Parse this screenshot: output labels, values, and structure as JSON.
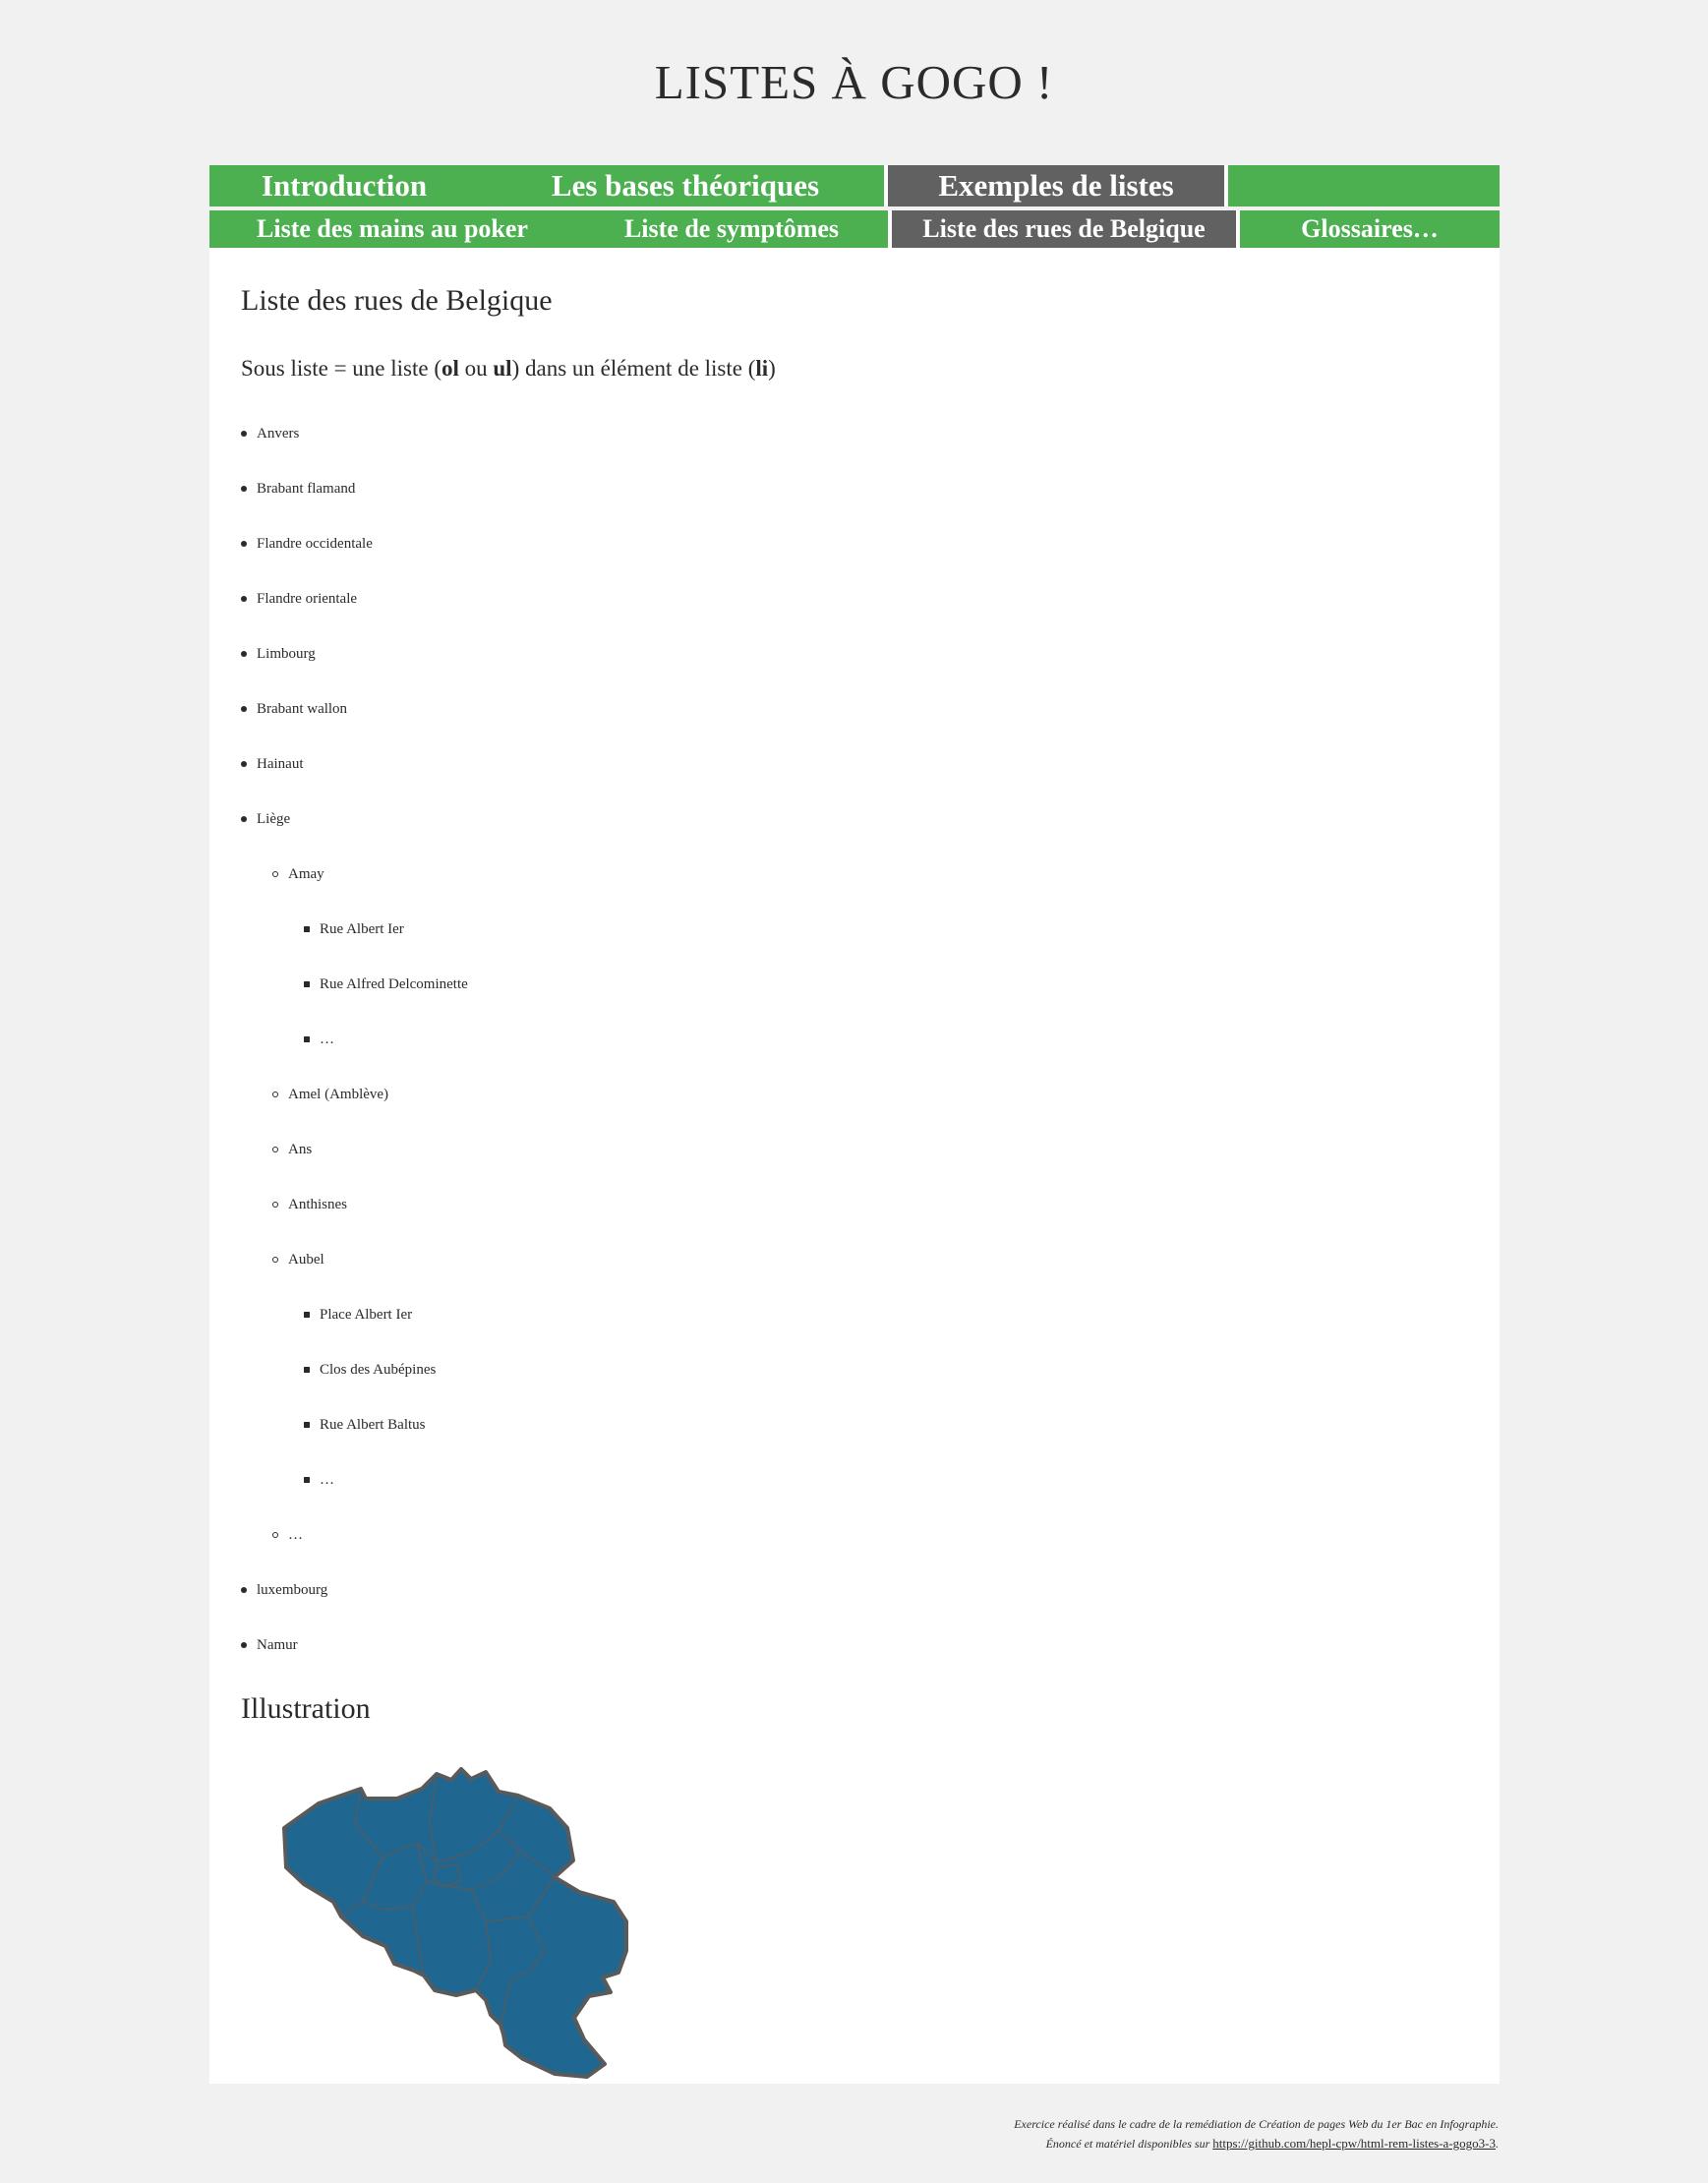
{
  "site": {
    "title": "LISTES À GOGO !"
  },
  "nav_main": [
    {
      "label": "Introduction",
      "active": false
    },
    {
      "label": "Les bases théoriques",
      "active": false
    },
    {
      "label": "Exemples de listes",
      "active": true
    }
  ],
  "nav_sub": [
    {
      "label": "Liste des mains au poker",
      "active": false
    },
    {
      "label": "Liste de symptômes",
      "active": false
    },
    {
      "label": "Liste des rues de Belgique",
      "active": true
    },
    {
      "label": "Glossaires…",
      "active": false
    }
  ],
  "page": {
    "heading": "Liste des rues de Belgique",
    "intro": {
      "t1": "Sous liste = une liste (",
      "b1": "ol",
      "t2": " ou ",
      "b2": "ul",
      "t3": ") dans un élément de liste (",
      "b3": "li",
      "t4": ")"
    }
  },
  "provinces": [
    {
      "label": "Anvers"
    },
    {
      "label": "Brabant flamand"
    },
    {
      "label": "Flandre occidentale"
    },
    {
      "label": "Flandre orientale"
    },
    {
      "label": "Limbourg"
    },
    {
      "label": "Brabant wallon"
    },
    {
      "label": "Hainaut"
    },
    {
      "label": "Liège",
      "children": [
        {
          "label": "Amay",
          "children": [
            {
              "label": "Rue Albert Ier"
            },
            {
              "label": "Rue Alfred Delcominette"
            },
            {
              "label": "…"
            }
          ]
        },
        {
          "label": "Amel (Amblève)"
        },
        {
          "label": "Ans"
        },
        {
          "label": "Anthisnes"
        },
        {
          "label": "Aubel",
          "children": [
            {
              "label": "Place Albert Ier"
            },
            {
              "label": "Clos des Aubépines"
            },
            {
              "label": "Rue Albert Baltus"
            },
            {
              "label": "…"
            }
          ]
        },
        {
          "label": "…"
        }
      ]
    },
    {
      "label": "luxembourg"
    },
    {
      "label": "Namur"
    }
  ],
  "illustration": {
    "heading": "Illustration",
    "map_fill": "#1f6690",
    "map_border": "#5a5a5a"
  },
  "colors": {
    "nav_green": "#4caf50",
    "nav_active": "#616161",
    "page_bg": "#f1f1f1",
    "content_bg": "#ffffff"
  },
  "footer": {
    "line1": "Exercice réalisé dans le cadre de la remédiation de Création de pages Web du 1er Bac en Infographie.",
    "line2_prefix": "Énoncé et matériel disponibles sur ",
    "link_text": "https://github.com/hepl-cpw/html-rem-listes-a-gogo3-3",
    "line2_suffix": "."
  }
}
